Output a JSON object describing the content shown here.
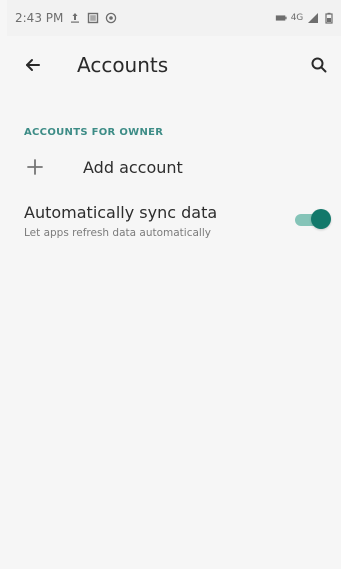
{
  "status_bar": {
    "time": "2:43 PM",
    "network": "4G"
  },
  "toolbar": {
    "title": "Accounts"
  },
  "accounts_section": {
    "header": "ACCOUNTS FOR OWNER",
    "add_account_label": "Add account"
  },
  "sync": {
    "title": "Automatically sync data",
    "subtitle": "Let apps refresh data automatically",
    "enabled": true
  },
  "colors": {
    "accent": "#3d8c86",
    "toggle_track": "#85c4b8",
    "toggle_thumb": "#12786a"
  }
}
